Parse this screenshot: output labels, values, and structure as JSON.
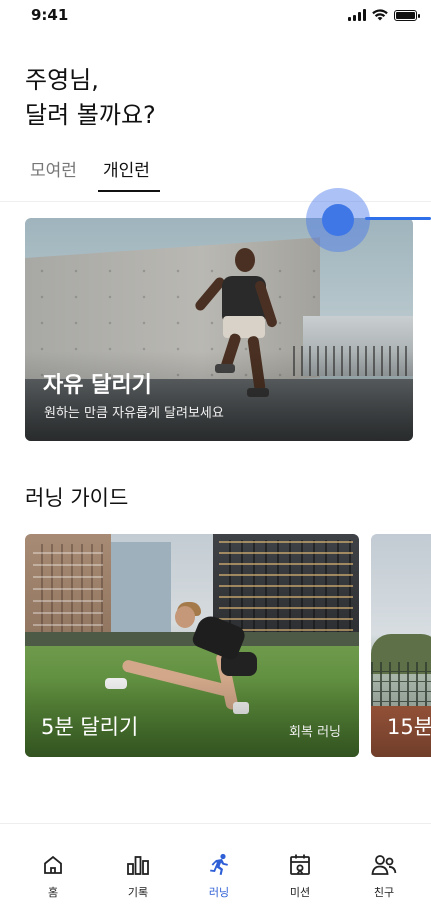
{
  "status_bar": {
    "time": "9:41"
  },
  "greeting": "주영님,\n달려 볼까요?",
  "tabs": [
    {
      "label": "모여런",
      "active": false
    },
    {
      "label": "개인런",
      "active": true
    }
  ],
  "hero": {
    "title": "자유 달리기",
    "subtitle": "원하는 만큼 자유롭게 달려보세요"
  },
  "section": {
    "title": "러닝 가이드"
  },
  "guides": [
    {
      "title": "5분 달리기",
      "tag": "회복 러닝"
    },
    {
      "title": "15분"
    }
  ],
  "bottom_nav": [
    {
      "label": "홈",
      "icon": "home-icon",
      "active": false
    },
    {
      "label": "기록",
      "icon": "bar-chart-icon",
      "active": false
    },
    {
      "label": "러닝",
      "icon": "running-icon",
      "active": true
    },
    {
      "label": "미션",
      "icon": "mission-icon",
      "active": false
    },
    {
      "label": "친구",
      "icon": "friends-icon",
      "active": false
    }
  ],
  "colors": {
    "accent": "#2e5fd6",
    "text": "#111111",
    "muted": "#777777"
  }
}
